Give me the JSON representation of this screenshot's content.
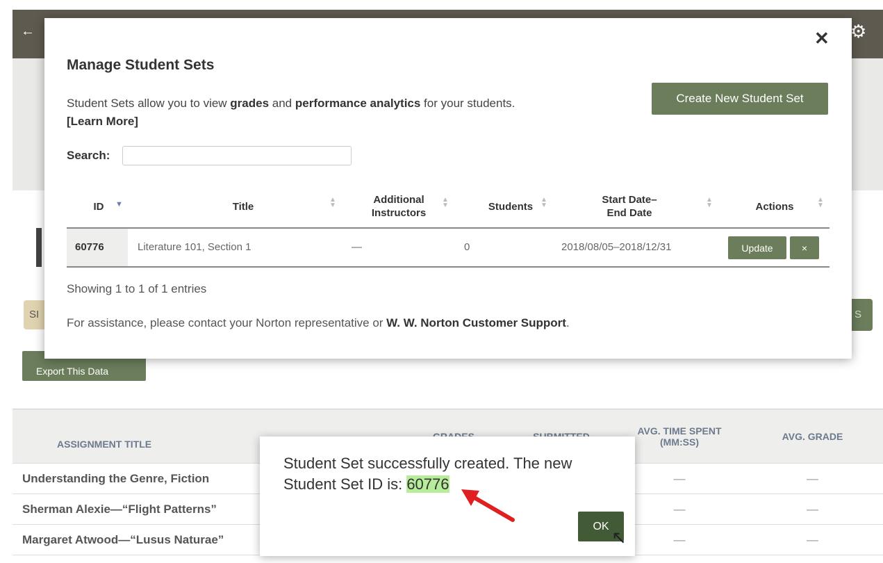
{
  "background": {
    "partial_left": "SI",
    "partial_right": "S",
    "export_label": "Export This Data",
    "table": {
      "headers": [
        "ASSIGNMENT TITLE",
        "GRADES",
        "SUBMITTED",
        "AVG. TIME SPENT (MM:SS)",
        "AVG. GRADE"
      ],
      "rows": [
        {
          "title": "Understanding the Genre, Fiction",
          "avg_time": "—",
          "avg_grade": "—"
        },
        {
          "title": "Sherman Alexie—“Flight Patterns”",
          "avg_time": "—",
          "avg_grade": "—"
        },
        {
          "title": "Margaret Atwood—“Lusus Naturae”",
          "avg_time": "—",
          "avg_grade": "—"
        }
      ]
    }
  },
  "modal": {
    "title": "Manage Student Sets",
    "desc_prefix": "Student Sets allow you to view ",
    "desc_bold1": "grades",
    "desc_mid": " and ",
    "desc_bold2": "performance analytics",
    "desc_suffix": " for your students.",
    "learn_more": "[Learn More]",
    "create_button": "Create New Student Set",
    "search_label": "Search:",
    "search_value": "",
    "columns": {
      "id": "ID",
      "title": "Title",
      "additional_line1": "Additional",
      "additional_line2": "Instructors",
      "students": "Students",
      "dates_line1": "Start Date–",
      "dates_line2": "End Date",
      "actions": "Actions"
    },
    "row": {
      "id": "60776",
      "title": "Literature 101, Section 1",
      "instructors": "—",
      "students": "0",
      "dates": "2018/08/05–2018/12/31",
      "update_label": "Update",
      "delete_label": "×"
    },
    "showing": "Showing 1 to 1 of 1 entries",
    "assist_prefix": "For assistance, please contact your Norton representative or ",
    "assist_link": "W. W. Norton Customer Support",
    "assist_suffix": "."
  },
  "alert": {
    "message_line1": "Student Set successfully created. The new",
    "message_line2_prefix": "Student Set ID is: ",
    "new_id": "60776",
    "ok_label": "OK"
  },
  "colors": {
    "button_green": "#6b7d5b",
    "ok_green": "#435a36",
    "highlight": "#b6ec9a",
    "arrow_red": "#e02020"
  }
}
